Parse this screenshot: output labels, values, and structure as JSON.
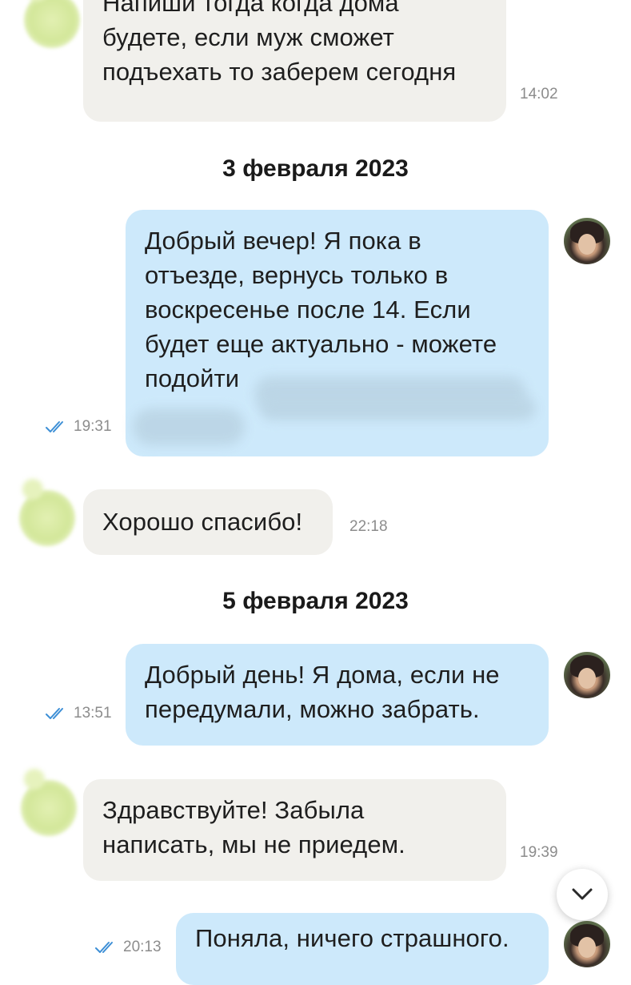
{
  "colors": {
    "incoming_bubble": "#f1f0ec",
    "outgoing_bubble": "#cde9fb",
    "read_check": "#3d8fd6",
    "meta_text": "#8c8c8c"
  },
  "messages": [
    {
      "kind": "message",
      "direction": "incoming",
      "lines": [
        "Напиши тогда когда дома",
        "будете, если муж сможет",
        "подъехать то заберем сегодня"
      ],
      "time": "14:02"
    },
    {
      "kind": "date",
      "label": "3 февраля 2023"
    },
    {
      "kind": "message",
      "direction": "outgoing",
      "lines": [
        "Добрый вечер! Я пока в",
        "отъезде, вернусь только в",
        "воскресенье после 14. Если",
        "будет еще актуально - можете",
        "подойти"
      ],
      "time": "19:31",
      "read": true,
      "redacted": true
    },
    {
      "kind": "message",
      "direction": "incoming",
      "lines": [
        "Хорошо спасибо!"
      ],
      "time": "22:18"
    },
    {
      "kind": "date",
      "label": "5 февраля 2023"
    },
    {
      "kind": "message",
      "direction": "outgoing",
      "lines": [
        "Добрый день! Я дома, если не",
        "передумали, можно забрать."
      ],
      "time": "13:51",
      "read": true
    },
    {
      "kind": "message",
      "direction": "incoming",
      "lines": [
        "Здравствуйте! Забыла",
        "написать, мы не приедем."
      ],
      "time": "19:39"
    },
    {
      "kind": "message",
      "direction": "outgoing",
      "lines": [
        "Поняла, ничего страшного."
      ],
      "time": "20:13",
      "read": true
    }
  ],
  "scroll_down_button": {
    "icon": "chevron-down-icon"
  }
}
